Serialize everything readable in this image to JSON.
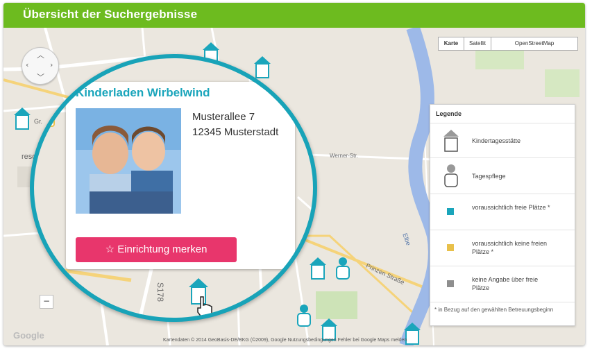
{
  "header": {
    "title": "Übersicht der Suchergebnisse"
  },
  "map_type": {
    "buttons": [
      "Karte",
      "Satellit",
      "OpenStreetMap"
    ],
    "active": "Karte"
  },
  "map_labels": {
    "road_left": "Werner-Str.",
    "road_b178": "S178",
    "road_right": "Prinzen Straße",
    "river": "Elbe",
    "place_left_1": "Gr.",
    "place_left_2": "resd"
  },
  "popup": {
    "title": "Kinderladen Wirbelwind",
    "address_line1": "Musterallee 7",
    "address_line2": "12345 Musterstadt",
    "save_button": "☆ Einrichtung merken"
  },
  "legend": {
    "title": "Legende",
    "items": [
      {
        "label": "Kindertagesstätte",
        "icon": "kita-house-icon"
      },
      {
        "label": "Tagespflege",
        "icon": "tagespflege-person-icon"
      },
      {
        "label": "voraussichtlich freie Plätze *",
        "icon": "free-places-square-icon",
        "color": "#1aa5bb"
      },
      {
        "label": "voraussichtlich keine freien Plätze *",
        "icon": "no-free-places-square-icon",
        "color": "#e8c04a"
      },
      {
        "label": "keine Angabe über freie Plätze",
        "icon": "no-info-square-icon",
        "color": "#8e8e8e"
      }
    ],
    "note": "* in Bezug auf den gewählten Betreuungsbeginn"
  },
  "attribution": "Kartendaten © 2014 GeoBasis-DE/BKG (©2009), Google    Nutzungsbedingungen    Fehler bei Google Maps melden",
  "google_logo": "Google",
  "colors": {
    "header": "#6dbb1f",
    "accent": "#1aa5bb",
    "button": "#e8366c"
  }
}
